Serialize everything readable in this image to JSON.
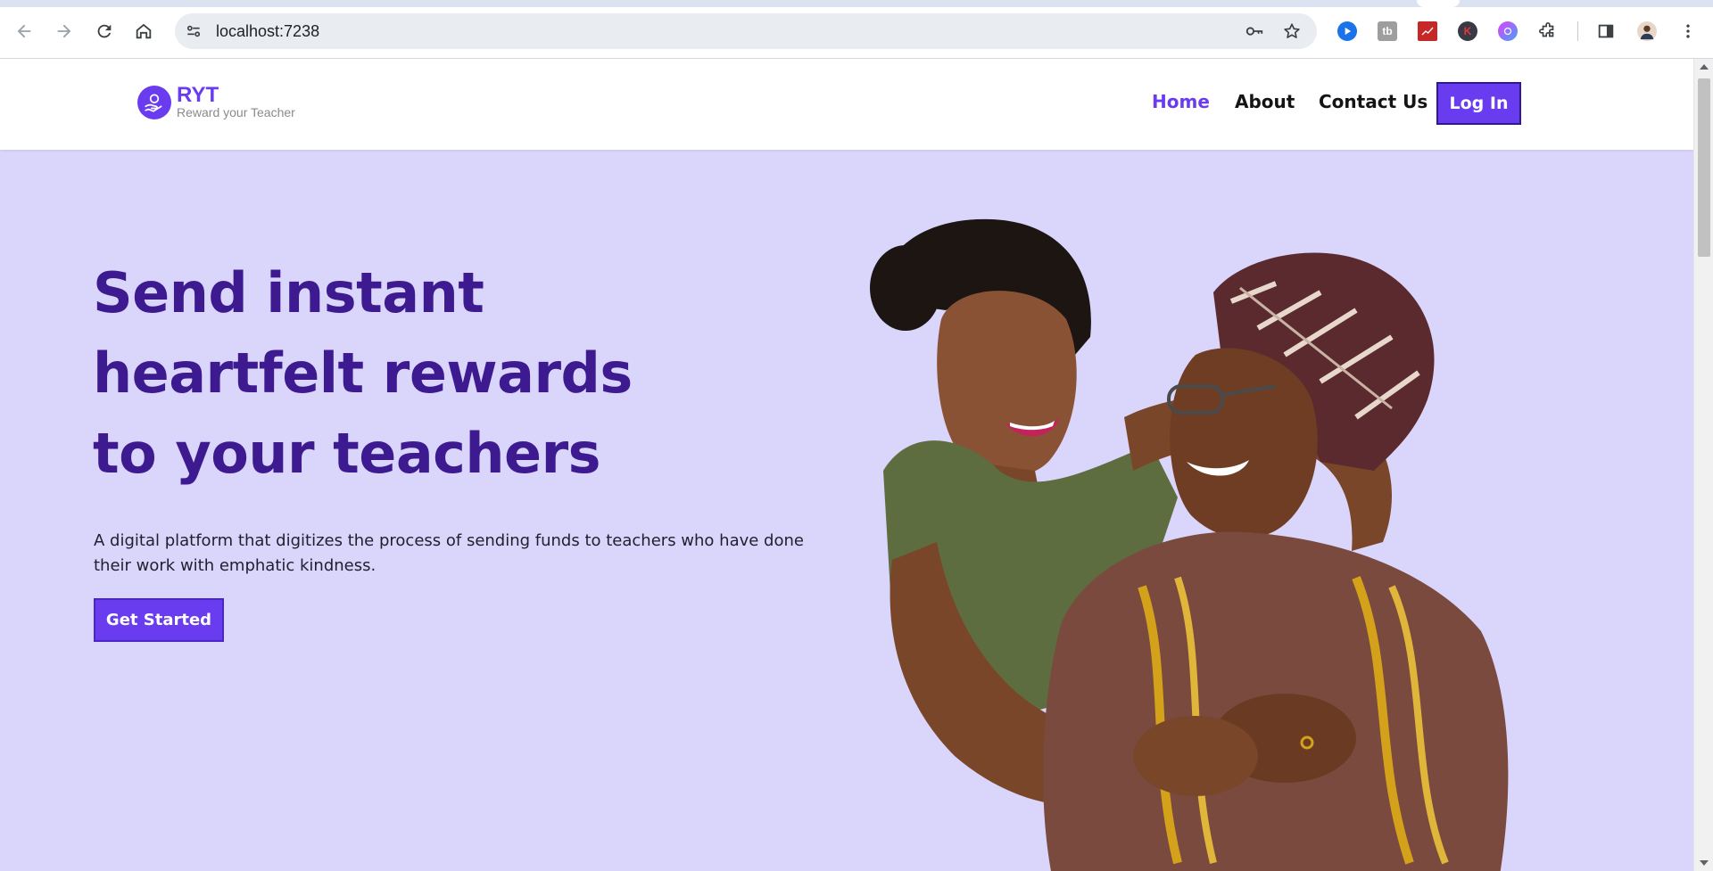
{
  "browser": {
    "url": "localhost:7238",
    "extensions": [
      "media-extension-icon",
      "tb-extension-icon",
      "chart-extension-icon",
      "k-extension-icon",
      "brain-extension-icon",
      "puzzle-extensions-icon"
    ]
  },
  "site": {
    "logo": {
      "name": "RYT",
      "tagline": "Reward your Teacher"
    },
    "nav": [
      {
        "label": "Home",
        "active": true
      },
      {
        "label": "About",
        "active": false
      },
      {
        "label": "Contact Us",
        "active": false
      }
    ],
    "login_label": "Log In"
  },
  "hero": {
    "heading_lines": [
      "Send instant",
      "heartfelt rewards",
      "to your teachers"
    ],
    "description": "A digital platform that digitizes the process of sending funds to teachers who have done their work with emphatic kindness.",
    "cta_label": "Get Started"
  },
  "colors": {
    "brand": "#6a3cf0",
    "heading": "#3d1a8f",
    "hero_bg": "#d9d5fb"
  }
}
